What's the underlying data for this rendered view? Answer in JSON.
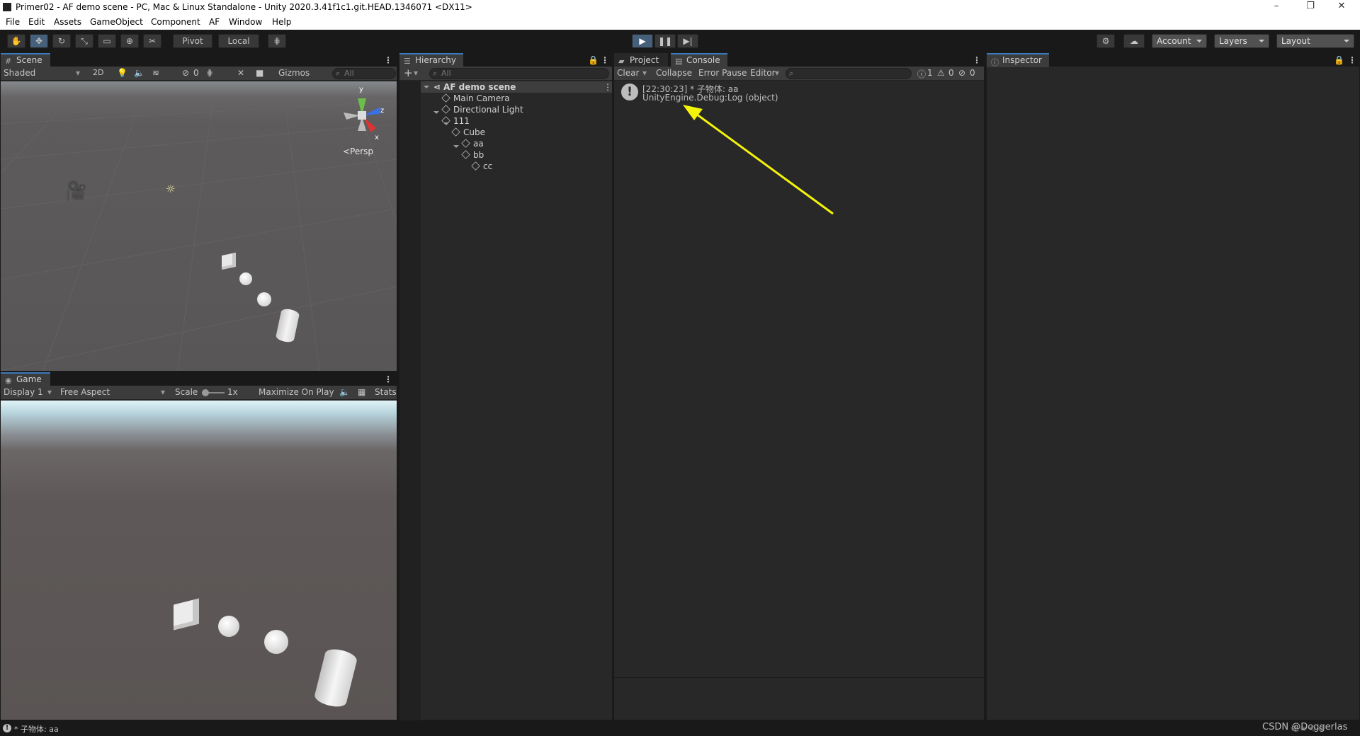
{
  "window": {
    "title": "Primer02 - AF demo scene - PC, Mac & Linux Standalone - Unity 2020.3.41f1c1.git.HEAD.1346071 <DX11>",
    "minimize": "–",
    "maximize": "❐",
    "close": "✕"
  },
  "menu": [
    "File",
    "Edit",
    "Assets",
    "GameObject",
    "Component",
    "AF",
    "Window",
    "Help"
  ],
  "toolbar": {
    "pivot": "Pivot",
    "local": "Local",
    "account": "Account",
    "layers": "Layers",
    "layout": "Layout"
  },
  "scene": {
    "tab": "Scene",
    "shading": "Shaded",
    "mode2d": "2D",
    "hidden_count": "0",
    "gizmos": "Gizmos",
    "search_placeholder": "All",
    "persp": "<Persp",
    "axis_y": "y",
    "axis_z": "z",
    "axis_x": "x"
  },
  "game": {
    "tab": "Game",
    "display": "Display 1",
    "aspect": "Free Aspect",
    "scale_label": "Scale",
    "scale_value": "1x",
    "maximize": "Maximize On Play",
    "stats": "Stats"
  },
  "hierarchy": {
    "tab": "Hierarchy",
    "add": "+",
    "search_placeholder": "All",
    "scene_name": "AF demo scene",
    "items": [
      "Main Camera",
      "Directional Light",
      "111",
      "Cube",
      "aa",
      "bb",
      "cc"
    ]
  },
  "console": {
    "tab_project": "Project",
    "tab_console": "Console",
    "clear": "Clear",
    "collapse": "Collapse",
    "error_pause": "Error Pause",
    "editor": "Editor",
    "log_count": "1",
    "warn_count": "0",
    "error_count": "0",
    "entry_line1": "[22:30:23] * 子物体: aa",
    "entry_line2": "UnityEngine.Debug:Log (object)"
  },
  "inspector": {
    "tab": "Inspector"
  },
  "statusbar": {
    "message": "* 子物体: aa",
    "watermark": "CSDN @Doggerlas"
  },
  "colors": {
    "annotation_arrow": "#f4f40a",
    "tab_accent": "#3a79bb",
    "play_active": "#46607c"
  }
}
